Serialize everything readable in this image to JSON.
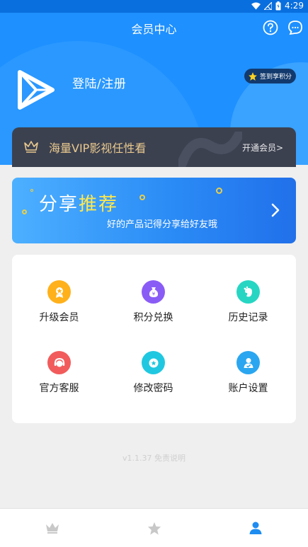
{
  "status_bar": {
    "time": "4:29"
  },
  "header": {
    "title": "会员中心"
  },
  "profile": {
    "login_text": "登陆/注册",
    "checkin_label": "签到享积分"
  },
  "vip": {
    "text": "海量VIP影视任性看",
    "button": "开通会员>"
  },
  "banner": {
    "title_white": "分享",
    "title_yellow": "推荐",
    "subtitle": "好的产品记得分享给好友哦"
  },
  "grid": {
    "items": [
      {
        "label": "升级会员",
        "icon": "upgrade-icon",
        "color": "#ffb11b"
      },
      {
        "label": "积分兑换",
        "icon": "points-icon",
        "color": "#8a5cf6"
      },
      {
        "label": "历史记录",
        "icon": "history-icon",
        "color": "#26d6c3"
      },
      {
        "label": "官方客服",
        "icon": "service-icon",
        "color": "#f25b5b"
      },
      {
        "label": "修改密码",
        "icon": "password-icon",
        "color": "#1fc8e0"
      },
      {
        "label": "账户设置",
        "icon": "account-icon",
        "color": "#2aa6f0"
      }
    ]
  },
  "footer": {
    "version": "v1.1.37 免责说明"
  },
  "tabbar": {
    "tabs": [
      {
        "icon": "crown-icon",
        "active": false
      },
      {
        "icon": "star-icon",
        "active": false
      },
      {
        "icon": "user-icon",
        "active": true
      }
    ]
  },
  "colors": {
    "primary": "#1e90ff",
    "active_tab": "#1e8cf0",
    "inactive_tab": "#c8c8c8",
    "vip_gold": "#e9c98e"
  }
}
